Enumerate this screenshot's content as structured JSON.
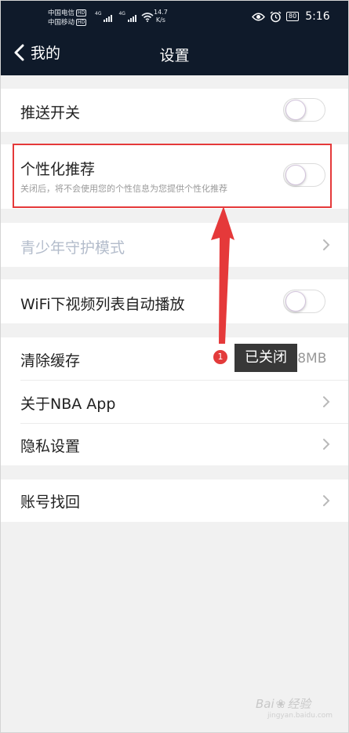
{
  "status_bar": {
    "carrier_1": "中国电信",
    "carrier_2": "中国移动",
    "hd": "HD",
    "network": "4G",
    "speed_value": "14.7",
    "speed_unit": "K/s",
    "battery": "80",
    "time": "5:16"
  },
  "header": {
    "back_label": "我的",
    "title": "设置"
  },
  "settings": {
    "push": {
      "label": "推送开关",
      "enabled": false
    },
    "personalized": {
      "label": "个性化推荐",
      "description": "关闭后，将不会使用您的个性信息为您提供个性化推荐",
      "enabled": false
    },
    "youth_mode": {
      "label": "青少年守护模式"
    },
    "wifi_autoplay": {
      "label": "WiFi下视频列表自动播放",
      "enabled": false
    },
    "clear_cache": {
      "label": "清除缓存",
      "value": "8.8MB"
    },
    "about": {
      "label": "关于NBA App"
    },
    "privacy": {
      "label": "隐私设置"
    },
    "account_recovery": {
      "label": "账号找回"
    }
  },
  "annotation": {
    "step_number": "1",
    "text": "已关闭",
    "color": "#e5393a"
  },
  "watermark": {
    "brand": "Bai",
    "brand_suffix": "经验",
    "url": "jingyan.baidu.com"
  }
}
